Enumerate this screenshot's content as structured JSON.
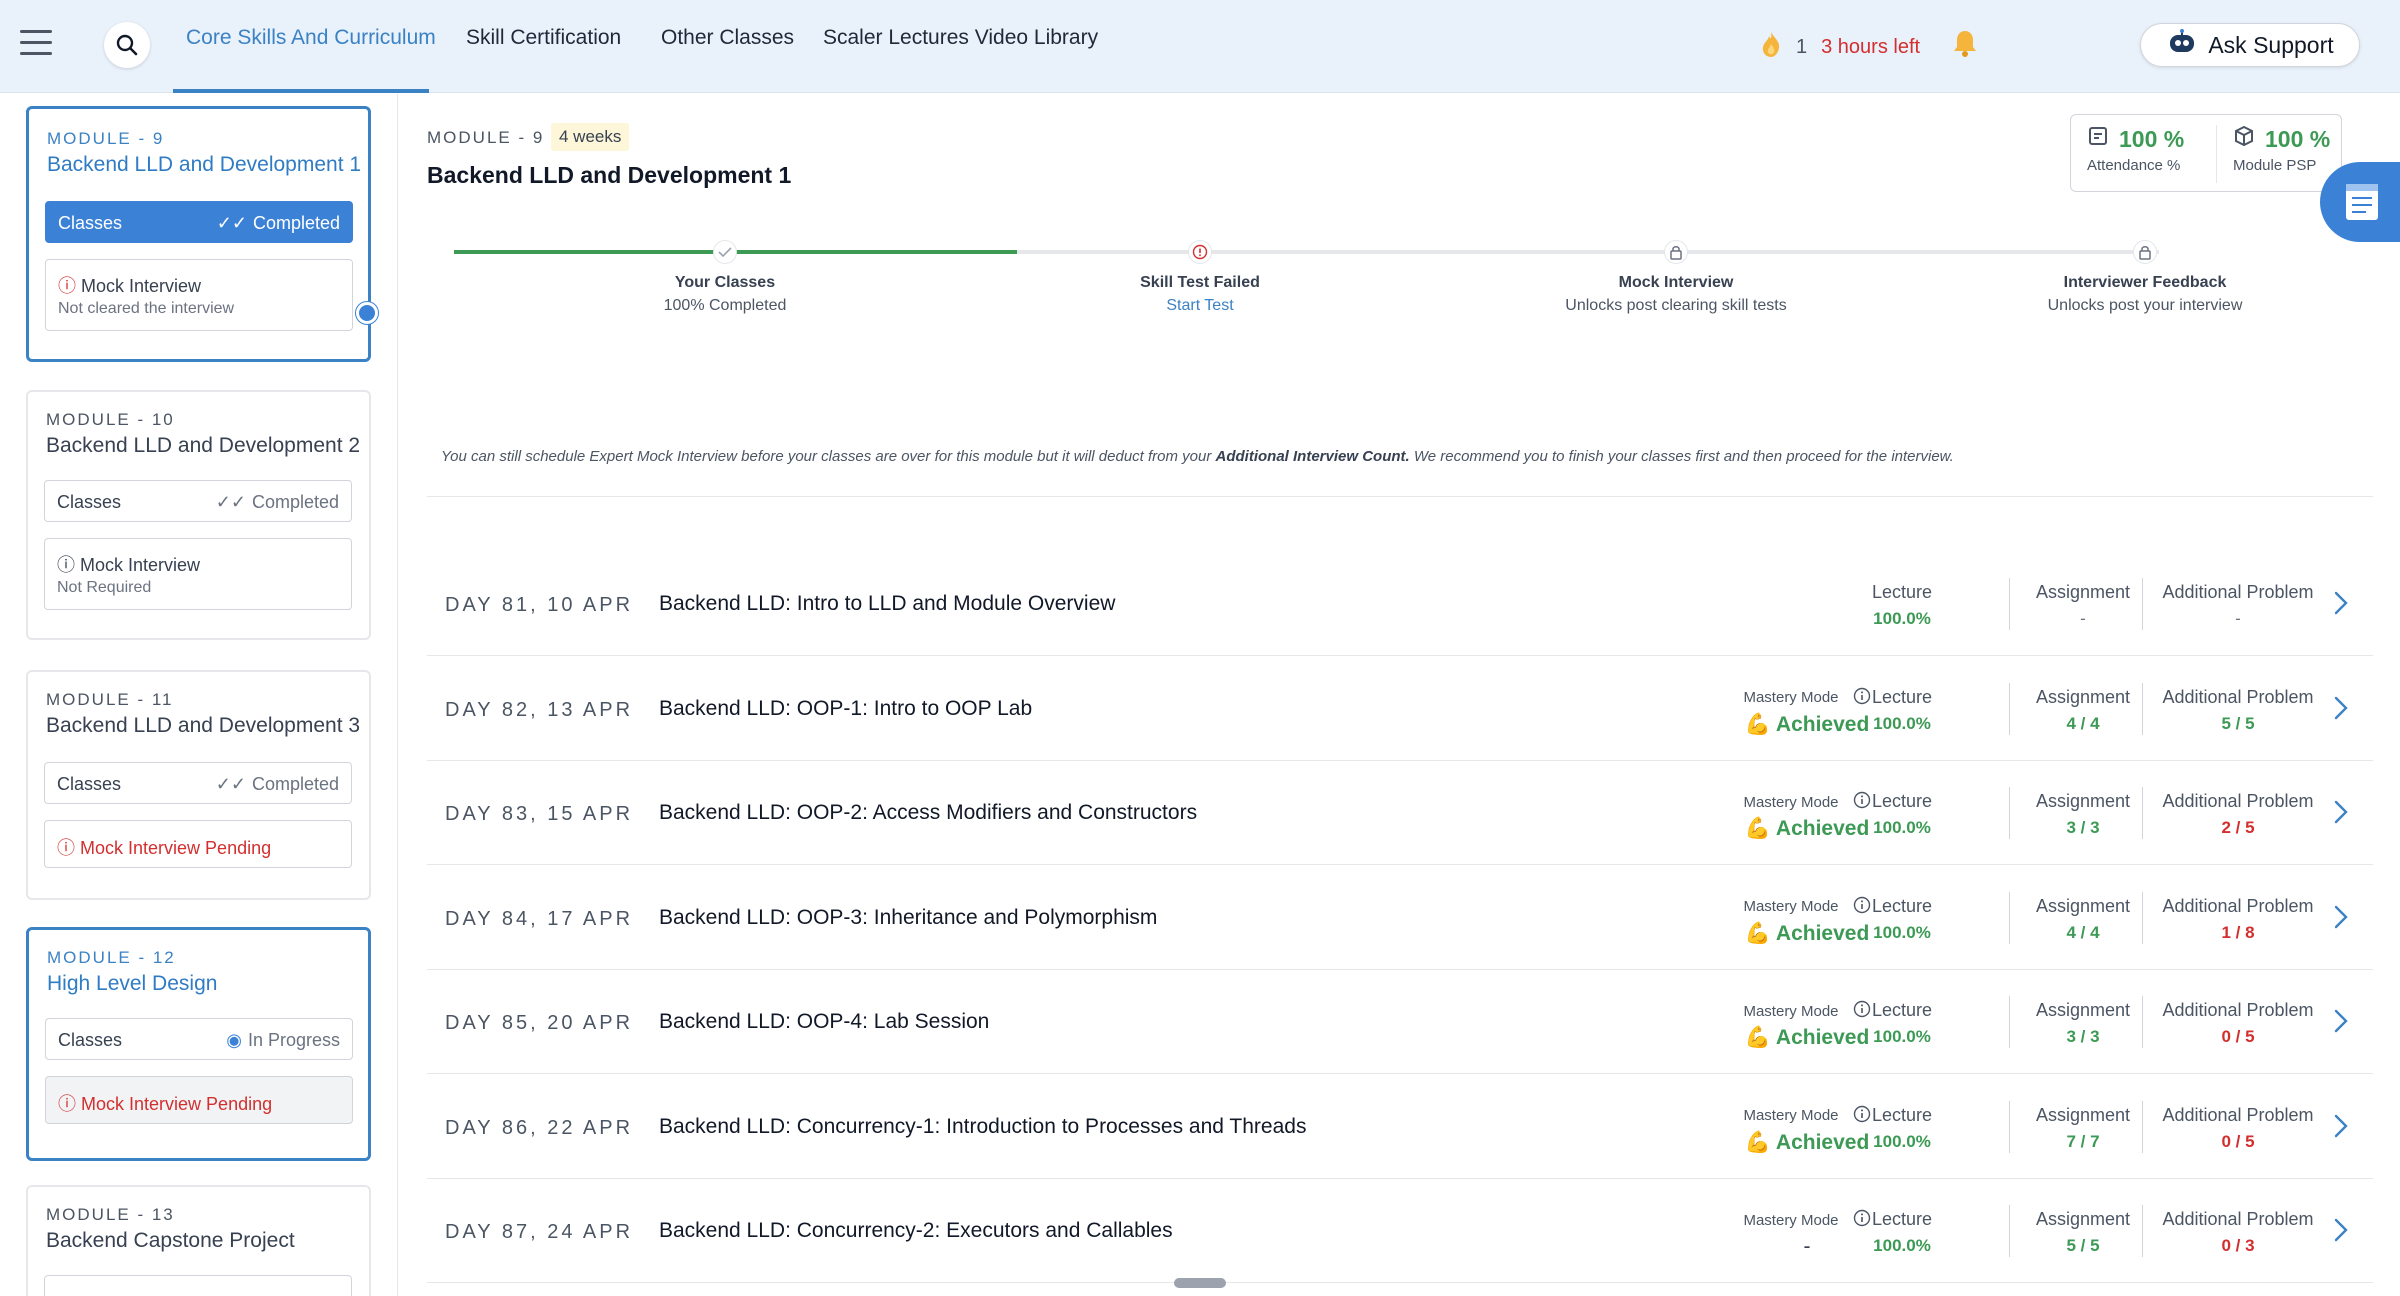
{
  "header": {
    "tabs": [
      {
        "label": "Core Skills And Curriculum"
      },
      {
        "label": "Skill Certification"
      },
      {
        "label": "Other Classes"
      },
      {
        "label": "Scaler Lectures Video Library"
      }
    ],
    "streak_count": "1",
    "hours_left": "3 hours left",
    "support_label": "Ask Support",
    "icons": [
      "menu-icon",
      "search-icon",
      "flame-icon",
      "bell-icon",
      "robot-icon"
    ]
  },
  "sidebar": {
    "modules": [
      {
        "number": "MODULE - 9",
        "title": "Backend LLD and Development 1",
        "classes_label": "Classes",
        "classes_status": "Completed",
        "mock_label": "Mock Interview",
        "mock_sub": "Not cleared the interview"
      },
      {
        "number": "MODULE - 10",
        "title": "Backend LLD and Development 2",
        "classes_label": "Classes",
        "classes_status": "Completed",
        "mock_label": "Mock Interview",
        "mock_sub": "Not Required"
      },
      {
        "number": "MODULE - 11",
        "title": "Backend LLD and Development 3",
        "classes_label": "Classes",
        "classes_status": "Completed",
        "mock_label": "Mock Interview Pending"
      },
      {
        "number": "MODULE - 12",
        "title": "High Level Design",
        "classes_label": "Classes",
        "classes_status": "In Progress",
        "mock_label": "Mock Interview Pending"
      },
      {
        "number": "MODULE - 13",
        "title": "Backend Capstone Project"
      }
    ]
  },
  "main": {
    "module_label": "MODULE - 9",
    "duration": "4 weeks",
    "title": "Backend LLD and Development 1",
    "stats": {
      "attendance_value": "100 %",
      "attendance_label": "Attendance %",
      "psp_value": "100 %",
      "psp_label": "Module PSP"
    },
    "progress_fraction": 0.33,
    "steps": [
      {
        "title": "Your Classes",
        "sub": "100% Completed"
      },
      {
        "title": "Skill Test Failed",
        "sub": "Start Test"
      },
      {
        "title": "Mock Interview",
        "sub": "Unlocks post clearing skill tests"
      },
      {
        "title": "Interviewer Feedback",
        "sub": "Unlocks post your interview"
      }
    ],
    "notice": {
      "part1": "You can still schedule Expert Mock Interview before your classes are over for this module but it will deduct from your ",
      "bold": "Additional Interview Count.",
      "part2": "  We recommend you to finish your classes first and then proceed for the interview."
    },
    "metric_labels": {
      "mastery": "Mastery Mode",
      "lecture": "Lecture",
      "assignment": "Assignment",
      "additional": "Additional Problem"
    },
    "days": [
      {
        "date": "DAY 81, 10 APR",
        "title": "Backend LLD: Intro to LLD and Module Overview",
        "mastery": "",
        "lecture": "100.0%",
        "assignment": "-",
        "additional": "-",
        "additional_status": "plain"
      },
      {
        "date": "DAY 82, 13 APR",
        "title": "Backend LLD: OOP-1: Intro to OOP Lab",
        "mastery": "💪 Achieved",
        "lecture": "100.0%",
        "assignment": "4 / 4",
        "additional": "5 / 5",
        "additional_status": "green"
      },
      {
        "date": "DAY 83, 15 APR",
        "title": "Backend LLD: OOP-2: Access Modifiers and Constructors",
        "mastery": "💪 Achieved",
        "lecture": "100.0%",
        "assignment": "3 / 3",
        "additional": "2 / 5",
        "additional_status": "red"
      },
      {
        "date": "DAY 84, 17 APR",
        "title": "Backend LLD: OOP-3: Inheritance and Polymorphism",
        "mastery": "💪 Achieved",
        "lecture": "100.0%",
        "assignment": "4 / 4",
        "additional": "1 / 8",
        "additional_status": "red"
      },
      {
        "date": "DAY 85, 20 APR",
        "title": "Backend LLD: OOP-4: Lab Session",
        "mastery": "💪 Achieved",
        "lecture": "100.0%",
        "assignment": "3 / 3",
        "additional": "0 / 5",
        "additional_status": "red"
      },
      {
        "date": "DAY 86, 22 APR",
        "title": "Backend LLD: Concurrency-1: Introduction to Processes and Threads",
        "mastery": "💪 Achieved",
        "lecture": "100.0%",
        "assignment": "7 / 7",
        "additional": "0 / 5",
        "additional_status": "red"
      },
      {
        "date": "DAY 87, 24 APR",
        "title": "Backend LLD: Concurrency-2: Executors and Callables",
        "mastery": "-",
        "lecture": "100.0%",
        "assignment": "5 / 5",
        "additional": "0 / 3",
        "additional_status": "red"
      }
    ]
  }
}
